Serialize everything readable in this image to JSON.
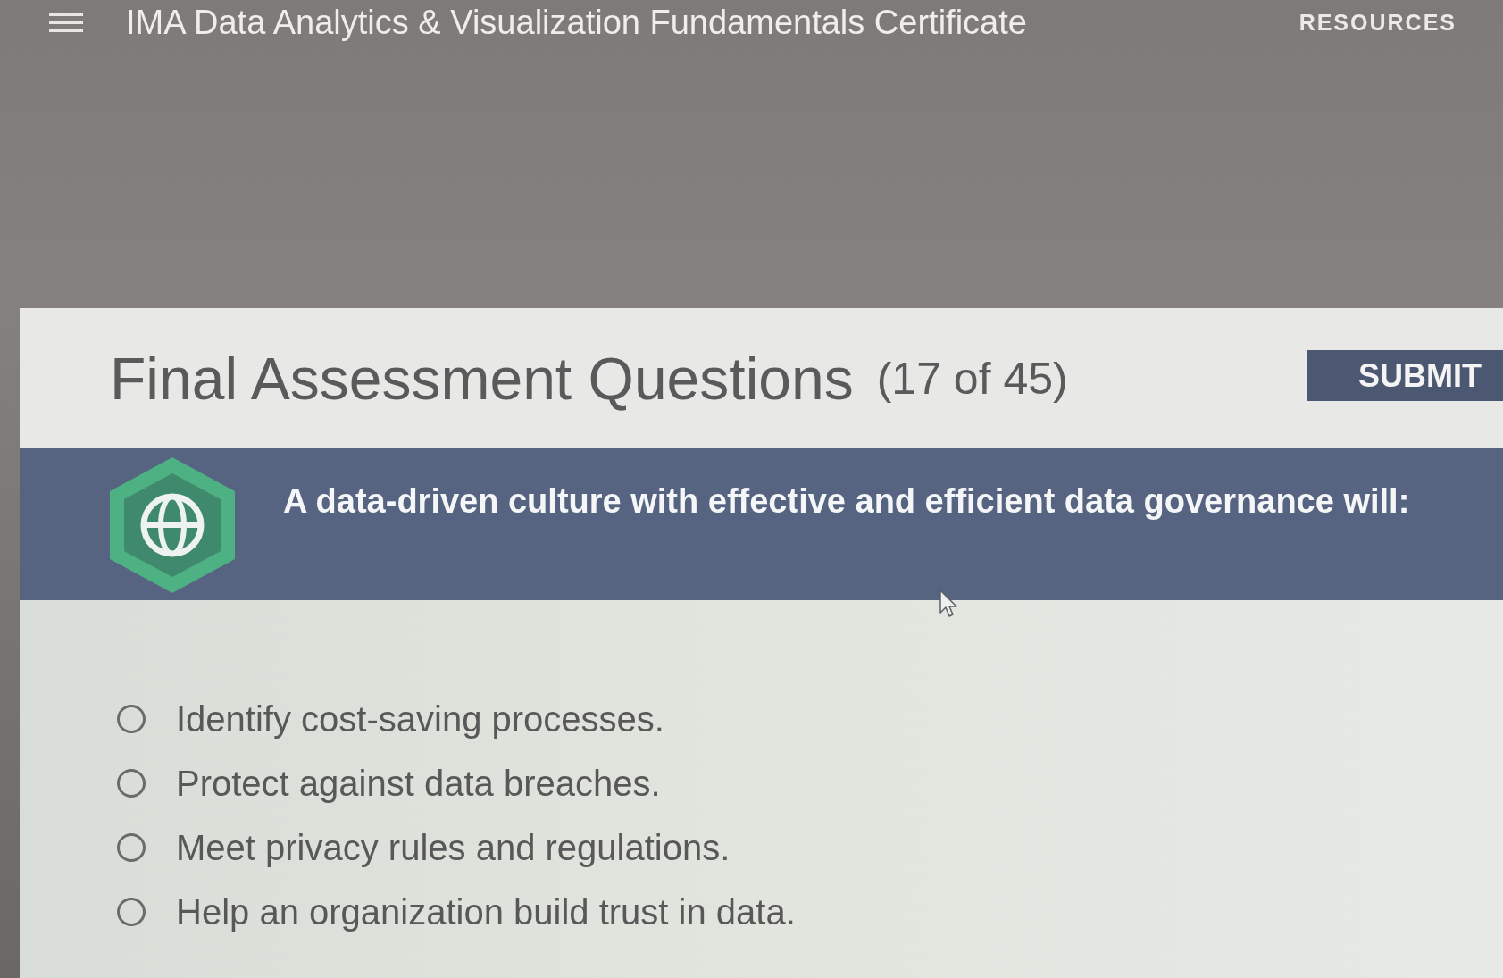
{
  "top_bar": {
    "title": "IMA Data Analytics & Visualization Fundamentals Certificate",
    "nav_links": [
      "RESOURCES"
    ]
  },
  "header": {
    "title": "Final Assessment Questions",
    "progress": "(17 of 45)",
    "submit_button": "SUBMIT"
  },
  "question": {
    "text": "A data-driven culture with effective and efficient data governance will:"
  },
  "options": [
    {
      "label": "Identify cost-saving processes.",
      "selected": false
    },
    {
      "label": "Protect against data breaches.",
      "selected": false
    },
    {
      "label": "Meet privacy rules and regulations.",
      "selected": false
    },
    {
      "label": "Help an organization build trust in data.",
      "selected": false
    }
  ]
}
